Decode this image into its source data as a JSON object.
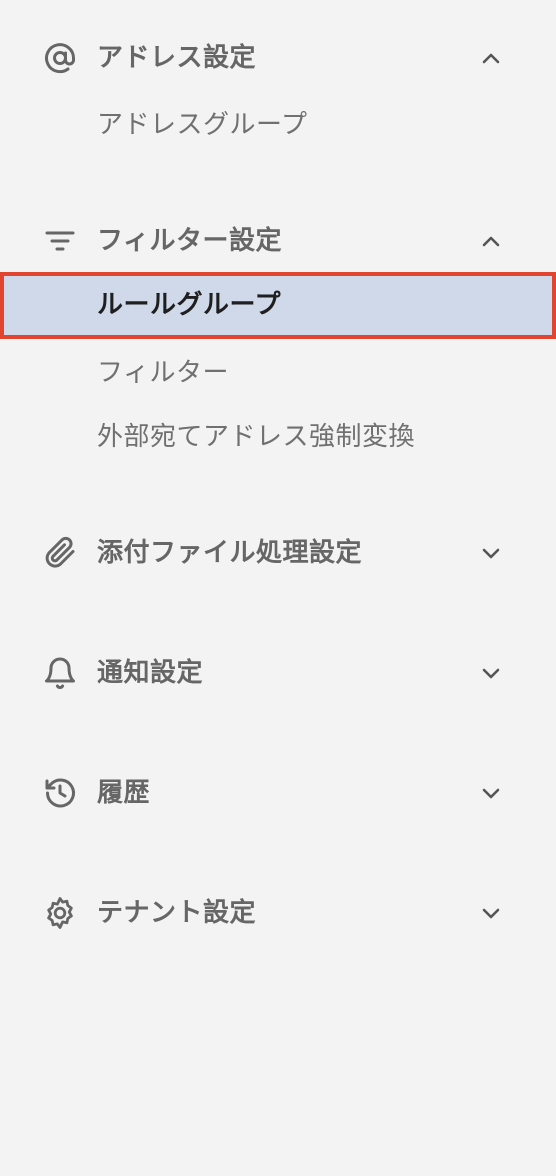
{
  "sidebar": {
    "sections": [
      {
        "label": "アドレス設定",
        "icon": "at-sign-icon",
        "expanded": true,
        "items": [
          {
            "label": "アドレスグループ",
            "active": false
          }
        ]
      },
      {
        "label": "フィルター設定",
        "icon": "filter-icon",
        "expanded": true,
        "items": [
          {
            "label": "ルールグループ",
            "active": true
          },
          {
            "label": "フィルター",
            "active": false
          },
          {
            "label": "外部宛てアドレス強制変換",
            "active": false
          }
        ]
      },
      {
        "label": "添付ファイル処理設定",
        "icon": "paperclip-icon",
        "expanded": false,
        "items": []
      },
      {
        "label": "通知設定",
        "icon": "bell-icon",
        "expanded": false,
        "items": []
      },
      {
        "label": "履歴",
        "icon": "history-icon",
        "expanded": false,
        "items": []
      },
      {
        "label": "テナント設定",
        "icon": "gear-icon",
        "expanded": false,
        "items": []
      }
    ]
  },
  "colors": {
    "background": "#f3f3f3",
    "text": "#666666",
    "active_background": "#cfd9ea",
    "active_text": "#1f1f1f",
    "highlight_border": "#e2452f"
  }
}
